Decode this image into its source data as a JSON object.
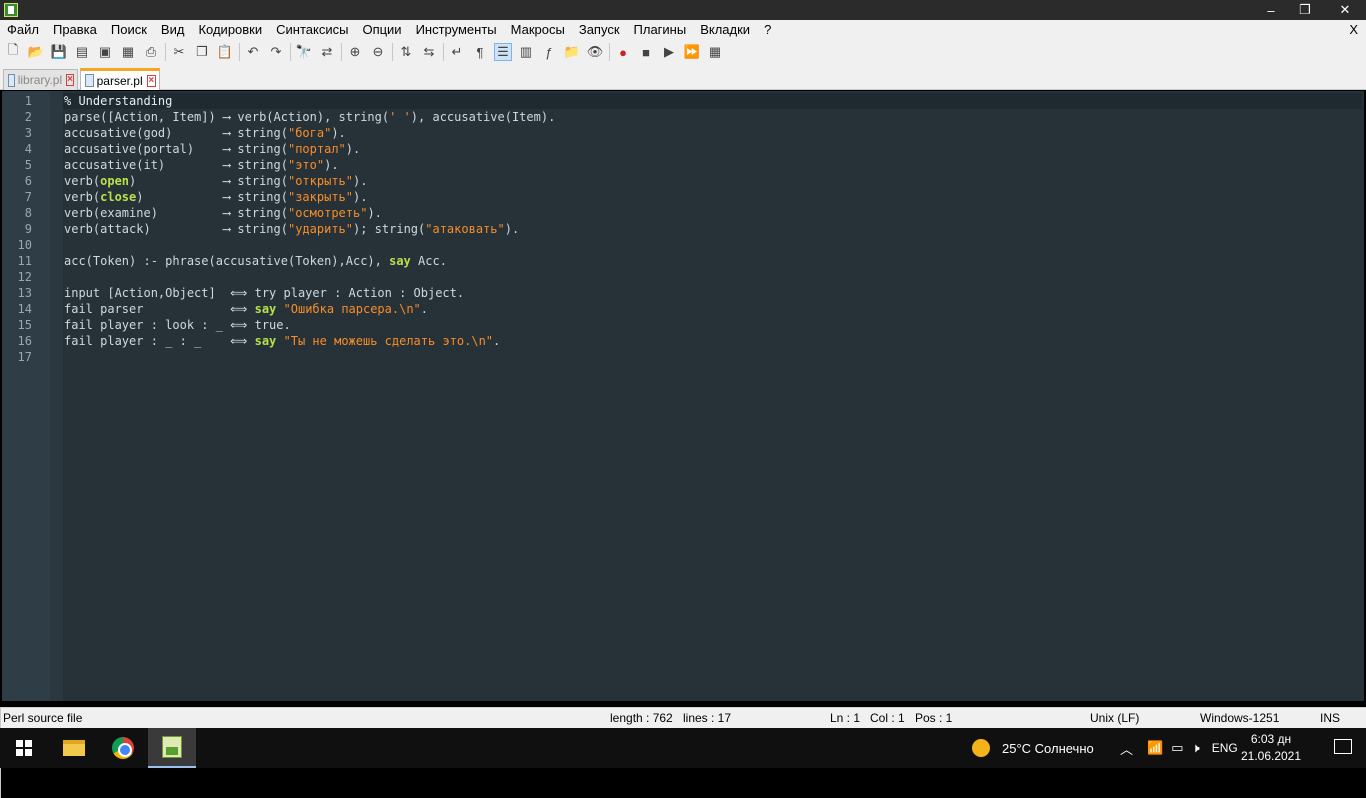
{
  "window": {
    "title": "",
    "controls": [
      "–",
      "❐",
      "✕"
    ]
  },
  "menu": {
    "items": [
      "Файл",
      "Правка",
      "Поиск",
      "Вид",
      "Кодировки",
      "Синтаксисы",
      "Опции",
      "Инструменты",
      "Макросы",
      "Запуск",
      "Плагины",
      "Вкладки",
      "?"
    ],
    "close": "X"
  },
  "toolbar": {
    "icons": [
      "new-file-icon",
      "open-file-icon",
      "save-icon",
      "save-all-icon",
      "close-icon",
      "close-all-icon",
      "print-icon",
      "cut-icon",
      "copy-icon",
      "paste-icon",
      "undo-icon",
      "redo-icon",
      "find-icon",
      "replace-icon",
      "zoom-in-icon",
      "zoom-out-icon",
      "sync-vertical-icon",
      "sync-horizontal-icon",
      "word-wrap-icon",
      "show-all-chars-icon",
      "indent-guide-icon",
      "document-map-icon",
      "function-list-icon",
      "folder-workspace-icon",
      "monitoring-icon",
      "record-macro-icon",
      "stop-macro-icon",
      "play-macro-icon",
      "run-macro-multiple-icon",
      "save-macro-icon"
    ]
  },
  "tabs": [
    {
      "label": "library.pl",
      "active": false
    },
    {
      "label": "parser.pl",
      "active": true
    }
  ],
  "editor": {
    "lines": [
      {
        "n": "1",
        "parts": [
          [
            "comment",
            "% Understanding"
          ]
        ]
      },
      {
        "n": "2",
        "parts": [
          [
            "plain",
            "parse([Action, Item]) ⟶ verb(Action), string("
          ],
          [
            "str",
            "' '"
          ],
          [
            "plain",
            "), accusative(Item)."
          ]
        ]
      },
      {
        "n": "3",
        "parts": [
          [
            "plain",
            "accusative(god)       ⟶ string("
          ],
          [
            "str",
            "\"бога\""
          ],
          [
            "plain",
            ")."
          ]
        ]
      },
      {
        "n": "4",
        "parts": [
          [
            "plain",
            "accusative(portal)    ⟶ string("
          ],
          [
            "str",
            "\"портал\""
          ],
          [
            "plain",
            ")."
          ]
        ]
      },
      {
        "n": "5",
        "parts": [
          [
            "plain",
            "accusative(it)        ⟶ string("
          ],
          [
            "str",
            "\"это\""
          ],
          [
            "plain",
            ")."
          ]
        ]
      },
      {
        "n": "6",
        "parts": [
          [
            "plain",
            "verb("
          ],
          [
            "kw",
            "open"
          ],
          [
            "plain",
            ")            ⟶ string("
          ],
          [
            "str",
            "\"открыть\""
          ],
          [
            "plain",
            ")."
          ]
        ]
      },
      {
        "n": "7",
        "parts": [
          [
            "plain",
            "verb("
          ],
          [
            "kw",
            "close"
          ],
          [
            "plain",
            ")           ⟶ string("
          ],
          [
            "str",
            "\"закрыть\""
          ],
          [
            "plain",
            ")."
          ]
        ]
      },
      {
        "n": "8",
        "parts": [
          [
            "plain",
            "verb(examine)         ⟶ string("
          ],
          [
            "str",
            "\"осмотреть\""
          ],
          [
            "plain",
            ")."
          ]
        ]
      },
      {
        "n": "9",
        "parts": [
          [
            "plain",
            "verb(attack)          ⟶ string("
          ],
          [
            "str",
            "\"ударить\""
          ],
          [
            "plain",
            "); string("
          ],
          [
            "str",
            "\"атаковать\""
          ],
          [
            "plain",
            ")."
          ]
        ]
      },
      {
        "n": "10",
        "parts": []
      },
      {
        "n": "11",
        "parts": [
          [
            "plain",
            "acc(Token) :- phrase(accusative(Token),Acc), "
          ],
          [
            "kw",
            "say"
          ],
          [
            "plain",
            " Acc."
          ]
        ]
      },
      {
        "n": "12",
        "parts": []
      },
      {
        "n": "13",
        "parts": [
          [
            "plain",
            "input [Action,Object]  ⟺ try player : Action : Object."
          ]
        ]
      },
      {
        "n": "14",
        "parts": [
          [
            "plain",
            "fail parser            ⟺ "
          ],
          [
            "kw",
            "say"
          ],
          [
            "plain",
            " "
          ],
          [
            "str",
            "\"Ошибка парсера.\\n\""
          ],
          [
            "plain",
            "."
          ]
        ]
      },
      {
        "n": "15",
        "parts": [
          [
            "plain",
            "fail player : look : _ ⟺ true."
          ]
        ]
      },
      {
        "n": "16",
        "parts": [
          [
            "plain",
            "fail player : _ : _    ⟺ "
          ],
          [
            "kw",
            "say"
          ],
          [
            "plain",
            " "
          ],
          [
            "str",
            "\"Ты не можешь сделать это.\\n\""
          ],
          [
            "plain",
            "."
          ]
        ]
      },
      {
        "n": "17",
        "parts": []
      }
    ]
  },
  "status": {
    "filetype": "Perl source file",
    "length": "length : 762",
    "lines": "lines : 17",
    "ln": "Ln : 1",
    "col": "Col : 1",
    "pos": "Pos : 1",
    "eol": "Unix (LF)",
    "encoding": "Windows-1251",
    "mode": "INS"
  },
  "taskbar": {
    "weather": "25°C  Солнечно",
    "lang": "ENG",
    "time": "6:03 дн",
    "date": "21.06.2021"
  }
}
